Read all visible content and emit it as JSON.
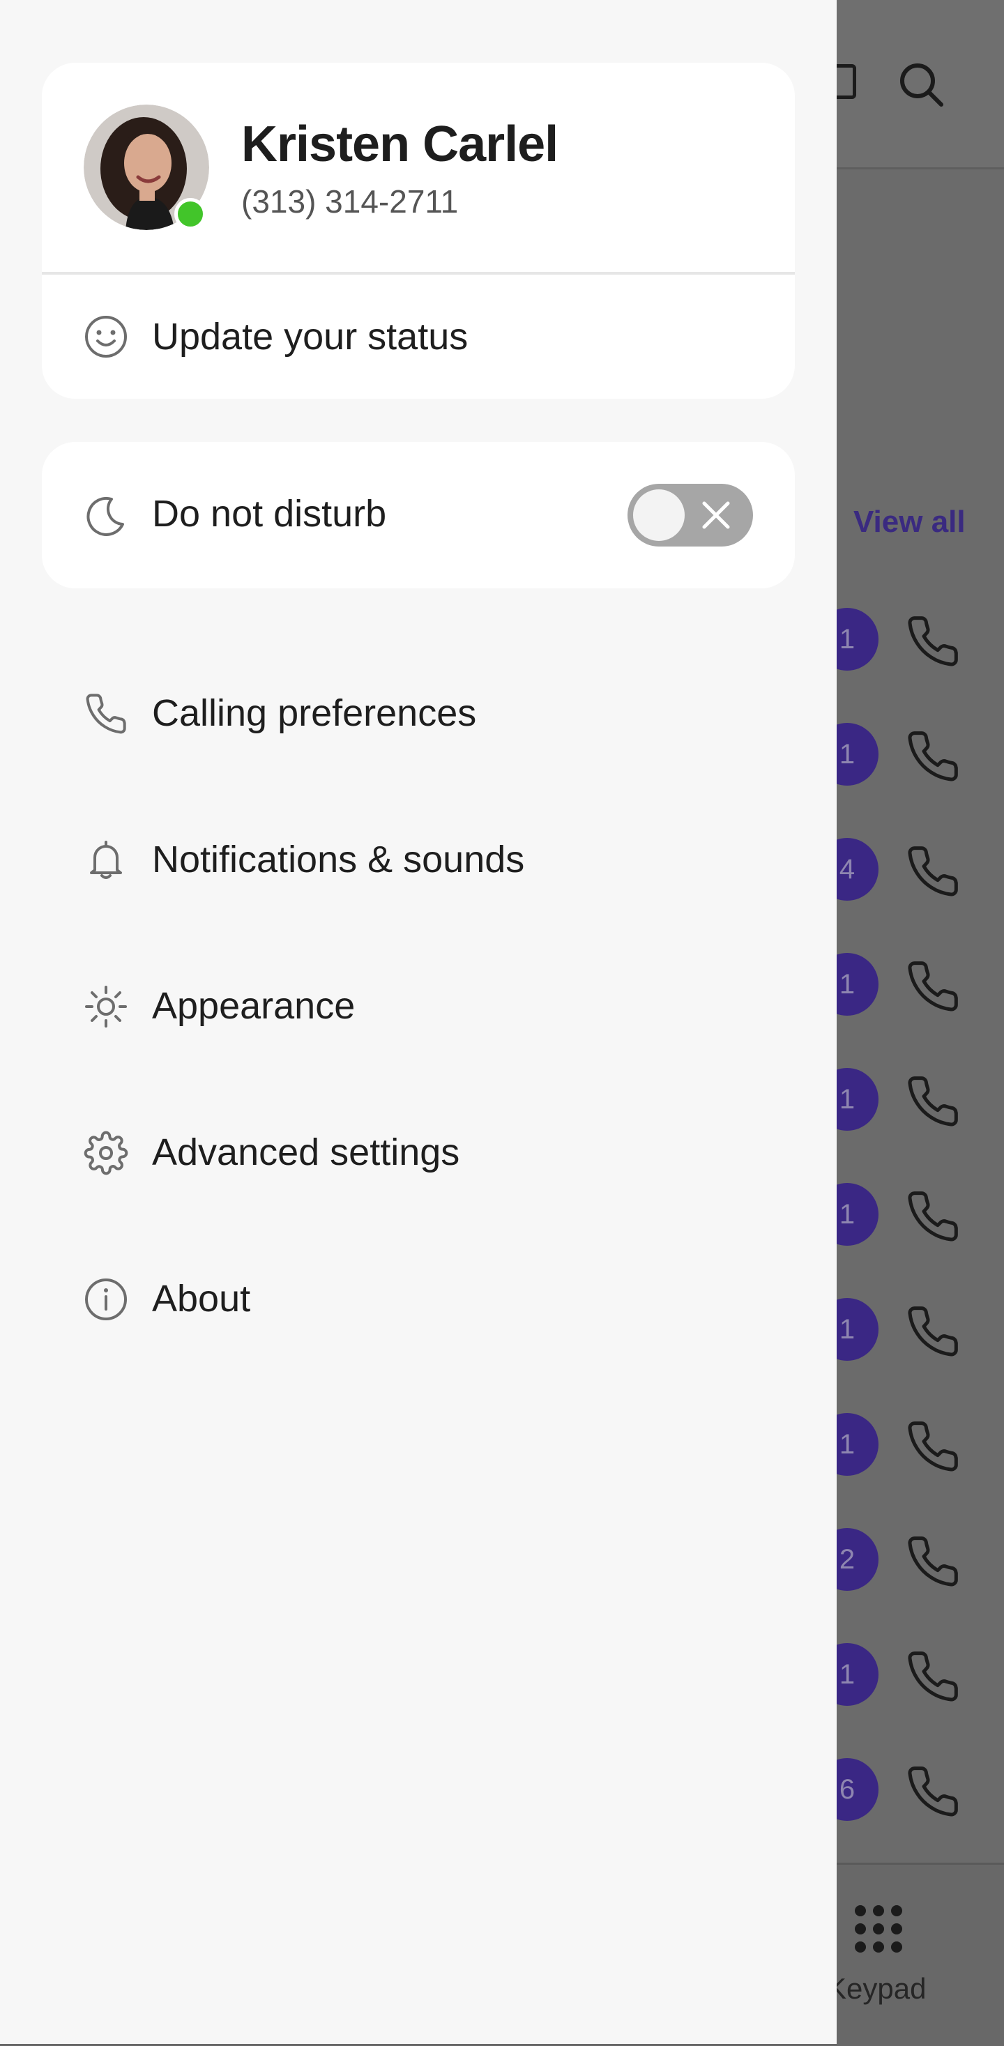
{
  "background": {
    "view_all_label": "View all",
    "badges": [
      "1",
      "1",
      "4",
      "1",
      "1",
      "1",
      "1",
      "1",
      "2",
      "1",
      "6"
    ],
    "keypad_label": "Keypad"
  },
  "profile": {
    "name": "Kristen Carlel",
    "phone": "(313) 314-2711",
    "presence_color": "#42c52a"
  },
  "status": {
    "label": "Update your status",
    "icon": "smiley-icon"
  },
  "dnd": {
    "label": "Do not disturb",
    "icon": "moon-icon",
    "enabled": false
  },
  "menu": [
    {
      "label": "Calling preferences",
      "icon": "phone-icon"
    },
    {
      "label": "Notifications & sounds",
      "icon": "bell-icon"
    },
    {
      "label": "Appearance",
      "icon": "sun-icon"
    },
    {
      "label": "Advanced settings",
      "icon": "gear-icon"
    },
    {
      "label": "About",
      "icon": "info-icon"
    }
  ],
  "colors": {
    "accent": "#3a2784",
    "drawer_bg": "#f7f7f7",
    "toggle_off": "#a6a6a6"
  }
}
